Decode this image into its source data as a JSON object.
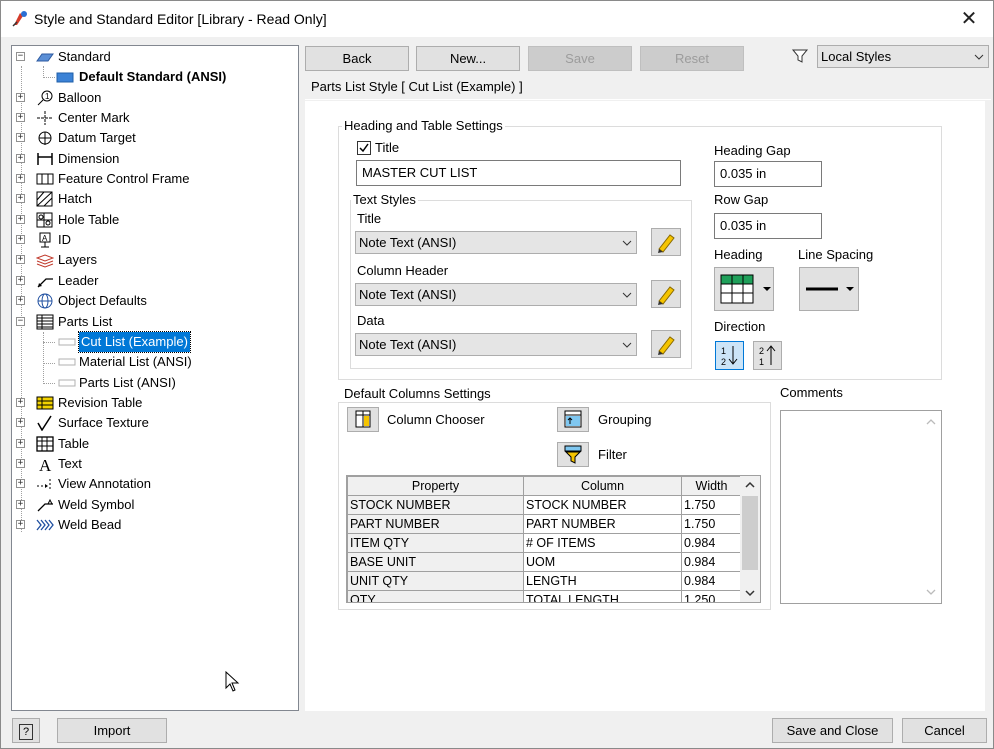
{
  "window": {
    "title": "Style and Standard Editor [Library - Read Only]",
    "close_glyph": "✕"
  },
  "tree": {
    "standard": {
      "label": "Standard",
      "icon": "standard-icon"
    },
    "default_standard": {
      "label": "Default Standard (ANSI)",
      "icon": "standard-item-icon"
    },
    "items": [
      {
        "label": "Balloon",
        "icon": "balloon-icon"
      },
      {
        "label": "Center Mark",
        "icon": "center-mark-icon"
      },
      {
        "label": "Datum Target",
        "icon": "datum-target-icon"
      },
      {
        "label": "Dimension",
        "icon": "dimension-icon"
      },
      {
        "label": "Feature Control Frame",
        "icon": "feature-control-frame-icon"
      },
      {
        "label": "Hatch",
        "icon": "hatch-icon"
      },
      {
        "label": "Hole Table",
        "icon": "hole-table-icon"
      },
      {
        "label": "ID",
        "icon": "id-icon"
      },
      {
        "label": "Layers",
        "icon": "layers-icon"
      },
      {
        "label": "Leader",
        "icon": "leader-icon"
      },
      {
        "label": "Object Defaults",
        "icon": "object-defaults-icon"
      },
      {
        "label": "Parts List",
        "icon": "parts-list-icon"
      }
    ],
    "parts_list_children": [
      {
        "label": "Cut List (Example)",
        "selected": true
      },
      {
        "label": "Material List (ANSI)"
      },
      {
        "label": "Parts List (ANSI)"
      }
    ],
    "items_after": [
      {
        "label": "Revision Table",
        "icon": "revision-table-icon"
      },
      {
        "label": "Surface Texture",
        "icon": "surface-texture-icon"
      },
      {
        "label": "Table",
        "icon": "table-icon"
      },
      {
        "label": "Text",
        "icon": "text-icon"
      },
      {
        "label": "View Annotation",
        "icon": "view-annotation-icon"
      },
      {
        "label": "Weld Symbol",
        "icon": "weld-symbol-icon"
      },
      {
        "label": "Weld Bead",
        "icon": "weld-bead-icon"
      }
    ]
  },
  "toolbar": {
    "back": "Back",
    "new": "New...",
    "save": "Save",
    "reset": "Reset",
    "filter_value": "Local Styles"
  },
  "panel": {
    "title": "Parts List Style [ Cut List (Example) ]",
    "heading_group": "Heading and Table Settings",
    "title_checkbox_label": "Title",
    "title_checked": true,
    "title_value": "MASTER CUT LIST",
    "text_styles_group": "Text Styles",
    "title_style_label": "Title",
    "title_style_value": "Note Text (ANSI)",
    "column_header_label": "Column Header",
    "column_header_value": "Note Text (ANSI)",
    "data_label": "Data",
    "data_value": "Note Text (ANSI)",
    "heading_gap_label": "Heading Gap",
    "heading_gap_value": "0.035 in",
    "row_gap_label": "Row Gap",
    "row_gap_value": "0.035 in",
    "heading_label": "Heading",
    "line_spacing_label": "Line Spacing",
    "direction_label": "Direction",
    "columns_group": "Default Columns Settings",
    "column_chooser": "Column Chooser",
    "grouping": "Grouping",
    "filter": "Filter",
    "comments_label": "Comments"
  },
  "columns_table": {
    "headers": [
      "Property",
      "Column",
      "Width"
    ],
    "rows": [
      [
        "STOCK NUMBER",
        "STOCK NUMBER",
        "1.750"
      ],
      [
        "PART NUMBER",
        "PART NUMBER",
        "1.750"
      ],
      [
        "ITEM QTY",
        "# OF ITEMS",
        "0.984"
      ],
      [
        "BASE UNIT",
        "UOM",
        "0.984"
      ],
      [
        "UNIT QTY",
        "LENGTH",
        "0.984"
      ],
      [
        "QTY",
        "TOTAL LENGTH",
        "1.250"
      ]
    ]
  },
  "footer": {
    "help": "?",
    "import": "Import",
    "save_and_close": "Save and Close",
    "cancel": "Cancel"
  },
  "colors": {
    "selection": "#0078d7",
    "accent_yellow": "#f5c400"
  }
}
